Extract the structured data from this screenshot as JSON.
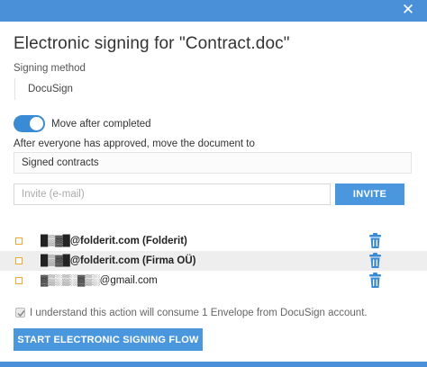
{
  "header": {
    "close_icon": "close-icon",
    "bar_color": "#4a90d9"
  },
  "dialog": {
    "title": "Electronic signing for \"Contract.doc\""
  },
  "signing_method": {
    "label": "Signing method",
    "value": "DocuSign"
  },
  "move_after": {
    "label": "Move after completed",
    "enabled": true
  },
  "destination": {
    "label": "After everyone has approved, move the document to",
    "value": "Signed contracts"
  },
  "invite": {
    "placeholder": "Invite (e-mail)",
    "button_label": "INVITE"
  },
  "recipients": [
    {
      "email": "█▒▓█@folderit.com (Folderit)",
      "checked": false,
      "delete_icon": "trash-icon"
    },
    {
      "email": "█▒▓█@folderit.com (Firma OÜ)",
      "checked": false,
      "delete_icon": "trash-icon"
    },
    {
      "email": "▓▒░▒░▓▒░@gmail.com",
      "checked": false,
      "delete_icon": "trash-icon"
    }
  ],
  "consent": {
    "label": "I understand this action will consume 1 Envelope from DocuSign account.",
    "checked": true
  },
  "start_button": {
    "label": "START ELECTRONIC SIGNING FLOW"
  },
  "colors": {
    "accent": "#4a97dd",
    "checkbox_border": "#f0a830",
    "trash": "#3a8bd6"
  }
}
